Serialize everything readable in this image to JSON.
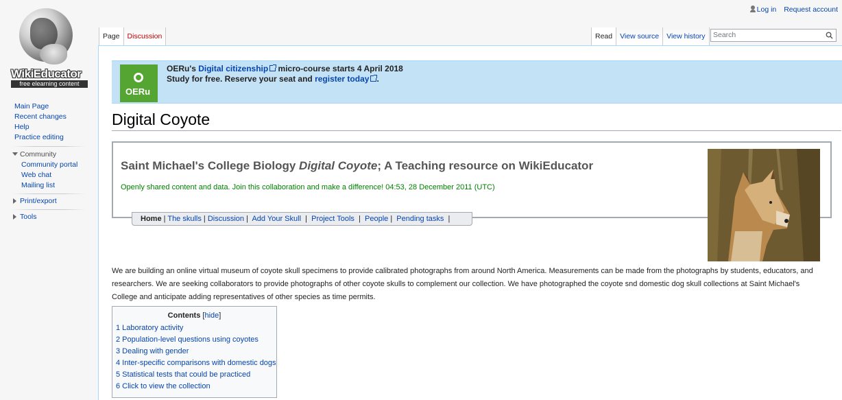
{
  "logo": {
    "title": "WikiEducator",
    "subtitle": "free elearning content"
  },
  "personal": {
    "login": "Log in",
    "request": "Request account"
  },
  "tabs": {
    "page": "Page",
    "discussion": "Discussion",
    "read": "Read",
    "view_source": "View source",
    "view_history": "View history"
  },
  "search": {
    "placeholder": "Search"
  },
  "sidebar": {
    "main_page": "Main Page",
    "recent_changes": "Recent changes",
    "help": "Help",
    "practice_editing": "Practice editing",
    "community": "Community",
    "community_portal": "Community portal",
    "web_chat": "Web chat",
    "mailing_list": "Mailing list",
    "print_export": "Print/export",
    "tools": "Tools"
  },
  "banner": {
    "logo_text": "OERu",
    "line1_prefix": "OERu's ",
    "line1_link": "Digital citizenship",
    "line1_suffix": " micro-course starts 4 April 2018",
    "line2_prefix": "Study for free. Reserve your seat and ",
    "line2_link": "register today",
    "line2_suffix": "."
  },
  "page_title": "Digital Coyote",
  "infobox": {
    "title_prefix": "Saint Michael's College Biology ",
    "title_em": "Digital Coyote",
    "title_suffix": "; A Teaching resource on WikiEducator",
    "subtitle": "Openly shared content and data. Join this collaboration and make a difference! 04:53, 28 December 2011 (UTC)",
    "nav": {
      "home": "Home",
      "skulls": "The skulls",
      "discussion": "Discussion",
      "add_skull": "Add Your Skull",
      "project_tools": "Project Tools",
      "people": "People",
      "pending": "Pending tasks"
    }
  },
  "body_text": "We are building an online virtual museum of coyote skull specimens to provide calibrated photographs from around North America. Measurements can be made from the photographs by students, educators, and researchers. We are seeking collaborators to provide photographs of other coyote skulls to complement our collection. We have photographed the coyote snd domestic dog skull collections at Saint Michael's College and anticipate adding representatives of other species as time permits.",
  "toc": {
    "title": "Contents",
    "hide": "hide",
    "items": [
      "1 Laboratory activity",
      "2 Population-level questions using coyotes",
      "3 Dealing with gender",
      "4 Inter-specific comparisons with domestic dogs",
      "5 Statistical tests that could be practiced",
      "6 Click to view the collection"
    ]
  },
  "colors": {
    "link": "#0645ad",
    "new_link": "#ba0000",
    "banner_bg": "#c4e2f5",
    "oeru_green": "#55a533",
    "subtitle_green": "#008000"
  }
}
